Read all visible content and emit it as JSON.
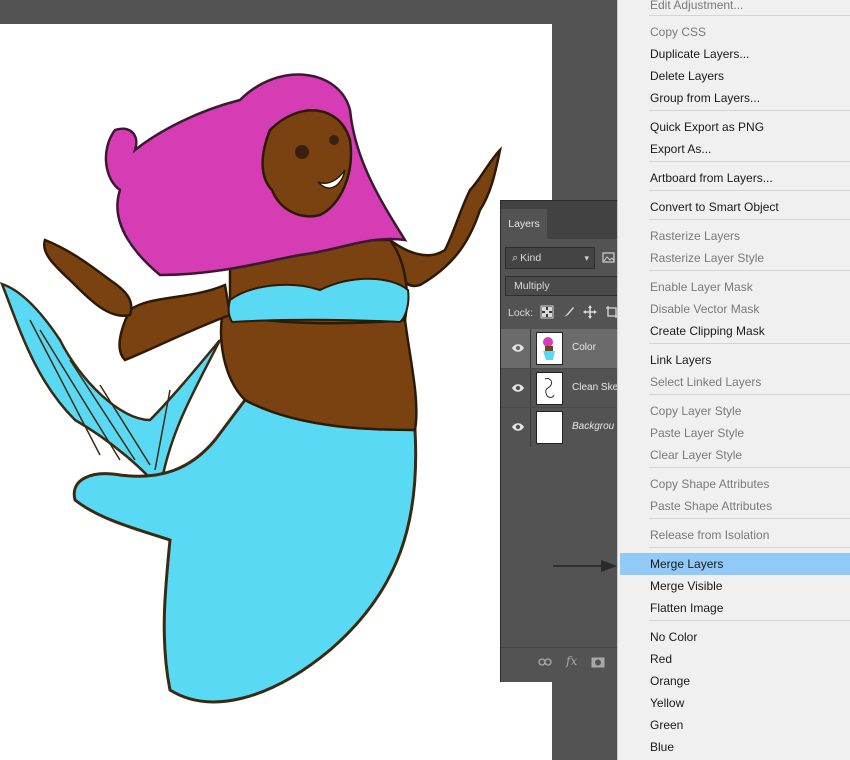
{
  "layers_panel": {
    "tab_label": "Layers",
    "filter_kind": "Kind",
    "blend_mode": "Multiply",
    "lock_label": "Lock:",
    "layers": [
      {
        "name": "Color",
        "visible": true,
        "selected": true
      },
      {
        "name": "Clean Ske",
        "visible": true,
        "selected": false
      },
      {
        "name": "Backgrou",
        "visible": true,
        "selected": false
      }
    ],
    "footer_icons": [
      "link-icon",
      "fx-icon",
      "mask-icon"
    ]
  },
  "context_menu": {
    "items": [
      {
        "label": "Edit Adjustment...",
        "enabled": false
      },
      {
        "label": "Copy CSS",
        "enabled": false
      },
      {
        "label": "Duplicate Layers...",
        "enabled": true
      },
      {
        "label": "Delete Layers",
        "enabled": true
      },
      {
        "label": "Group from Layers...",
        "enabled": true
      },
      {
        "label": "Quick Export as PNG",
        "enabled": true
      },
      {
        "label": "Export As...",
        "enabled": true
      },
      {
        "label": "Artboard from Layers...",
        "enabled": true
      },
      {
        "label": "Convert to Smart Object",
        "enabled": true
      },
      {
        "label": "Rasterize Layers",
        "enabled": false
      },
      {
        "label": "Rasterize Layer Style",
        "enabled": false
      },
      {
        "label": "Enable Layer Mask",
        "enabled": false
      },
      {
        "label": "Disable Vector Mask",
        "enabled": false
      },
      {
        "label": "Create Clipping Mask",
        "enabled": true
      },
      {
        "label": "Link Layers",
        "enabled": true
      },
      {
        "label": "Select Linked Layers",
        "enabled": false
      },
      {
        "label": "Copy Layer Style",
        "enabled": false
      },
      {
        "label": "Paste Layer Style",
        "enabled": false
      },
      {
        "label": "Clear Layer Style",
        "enabled": false
      },
      {
        "label": "Copy Shape Attributes",
        "enabled": false
      },
      {
        "label": "Paste Shape Attributes",
        "enabled": false
      },
      {
        "label": "Release from Isolation",
        "enabled": false
      },
      {
        "label": "Merge Layers",
        "enabled": true,
        "highlighted": true
      },
      {
        "label": "Merge Visible",
        "enabled": true
      },
      {
        "label": "Flatten Image",
        "enabled": true
      },
      {
        "label": "No Color",
        "enabled": true
      },
      {
        "label": "Red",
        "enabled": true
      },
      {
        "label": "Orange",
        "enabled": true
      },
      {
        "label": "Yellow",
        "enabled": true
      },
      {
        "label": "Green",
        "enabled": true
      },
      {
        "label": "Blue",
        "enabled": true
      }
    ],
    "highlight_color": "#91c9f7"
  },
  "colors": {
    "workspace": "#535353",
    "panel": "#535353",
    "selected_layer": "#6b6b6b",
    "hair": "#d63cb4",
    "skin": "#7a4210",
    "tail": "#5ad9f5"
  }
}
